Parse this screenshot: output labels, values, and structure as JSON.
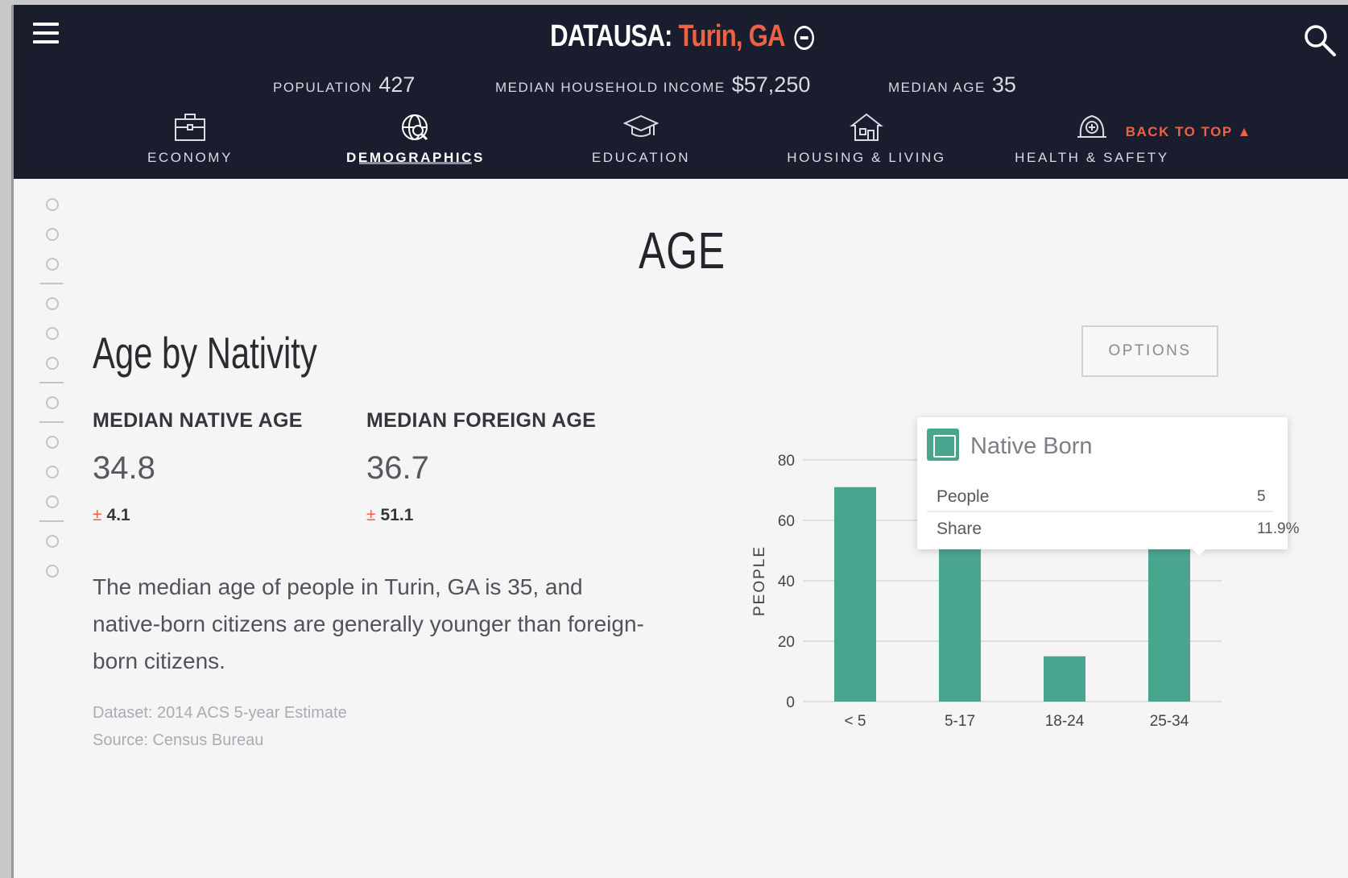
{
  "header": {
    "brand_prefix": "DATAUSA:",
    "brand_place": "Turin, GA",
    "stats": [
      {
        "label": "POPULATION",
        "value": "427"
      },
      {
        "label": "MEDIAN HOUSEHOLD INCOME",
        "value": "$57,250"
      },
      {
        "label": "MEDIAN AGE",
        "value": "35"
      }
    ],
    "back_to_top": "BACK TO TOP ▲",
    "nav": [
      {
        "label": "ECONOMY",
        "icon": "briefcase-icon"
      },
      {
        "label": "DEMOGRAPHICS",
        "icon": "globe-search-icon",
        "active": true
      },
      {
        "label": "EDUCATION",
        "icon": "graduation-cap-icon"
      },
      {
        "label": "HOUSING & LIVING",
        "icon": "house-icon"
      },
      {
        "label": "HEALTH & SAFETY",
        "icon": "medical-icon"
      }
    ],
    "accent_color": "#ef6145",
    "bg_color": "#191d2e"
  },
  "section": {
    "title": "AGE"
  },
  "topic": {
    "title": "Age by Nativity",
    "options_label": "OPTIONS",
    "metrics": [
      {
        "label": "MEDIAN NATIVE AGE",
        "value": "34.8",
        "moe_symbol": "±",
        "moe": "4.1"
      },
      {
        "label": "MEDIAN FOREIGN AGE",
        "value": "36.7",
        "moe_symbol": "±",
        "moe": "51.1"
      }
    ],
    "description": "The median age of people in Turin, GA is 35, and native-born citizens are generally younger than foreign-born citizens.",
    "dataset": "Dataset: 2014 ACS 5-year Estimate",
    "source": "Source: Census Bureau"
  },
  "tooltip": {
    "title": "Native Born",
    "rows": [
      {
        "key": "People",
        "value": "5"
      },
      {
        "key": "Share",
        "value": "11.9%"
      }
    ]
  },
  "chart_data": {
    "type": "bar",
    "ylabel": "PEOPLE",
    "ylim": [
      0,
      80
    ],
    "yticks": [
      0,
      20,
      40,
      60,
      80
    ],
    "categories": [
      "< 5",
      "5-17",
      "18-24",
      "25-34"
    ],
    "series": [
      {
        "color": "#4aa58f",
        "values": [
          71,
          60,
          15,
          60
        ]
      },
      {
        "color": "#3f5a7a",
        "values": [
          0,
          0,
          0,
          2
        ]
      }
    ]
  }
}
